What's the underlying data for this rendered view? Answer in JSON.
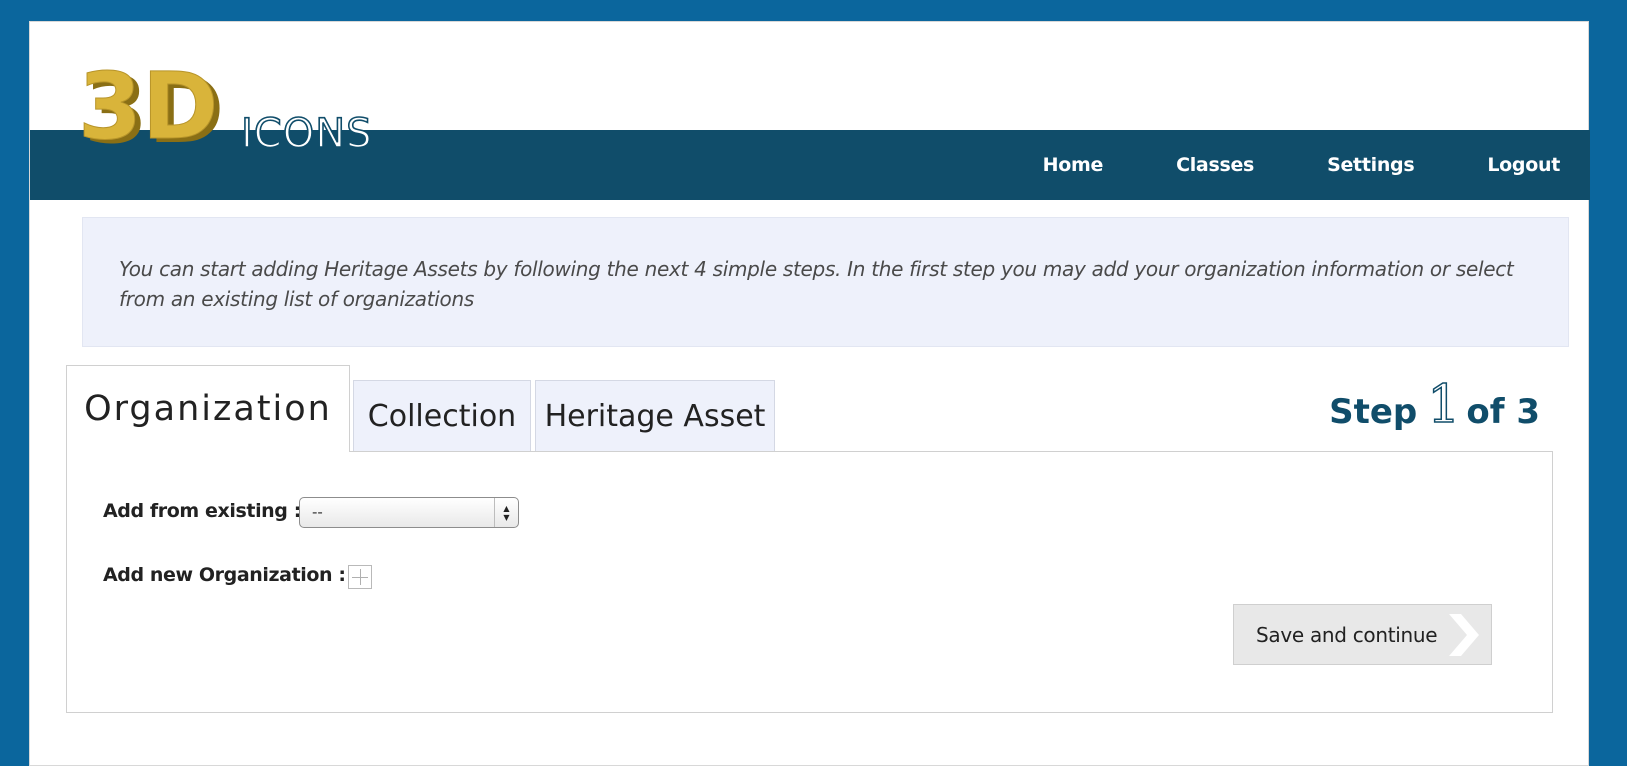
{
  "header": {
    "logo_mark": "3D",
    "logo_text": "ICONS",
    "nav": [
      "Home",
      "Classes",
      "Settings",
      "Logout"
    ]
  },
  "info": {
    "text": "You can start adding Heritage Assets by following the next 4 simple steps. In the first step you may add your organization information or select from an existing list of organizations"
  },
  "tabs": [
    {
      "label": "Organization",
      "active": true
    },
    {
      "label": "Collection",
      "active": false
    },
    {
      "label": "Heritage Asset",
      "active": false
    }
  ],
  "step": {
    "prefix": "Step",
    "current": "1",
    "suffix": "of 3"
  },
  "form": {
    "existing_label": "Add from existing :",
    "existing_value": "--",
    "new_label": "Add new Organization :",
    "save_label": "Save and continue"
  },
  "colors": {
    "background": "#0b669d",
    "navbar": "#104d6a",
    "logo_gold": "#d9b43a",
    "info_bg": "#eef1fb"
  },
  "icons": [
    "plus-icon",
    "chevron-right-icon",
    "select-arrows-icon"
  ]
}
